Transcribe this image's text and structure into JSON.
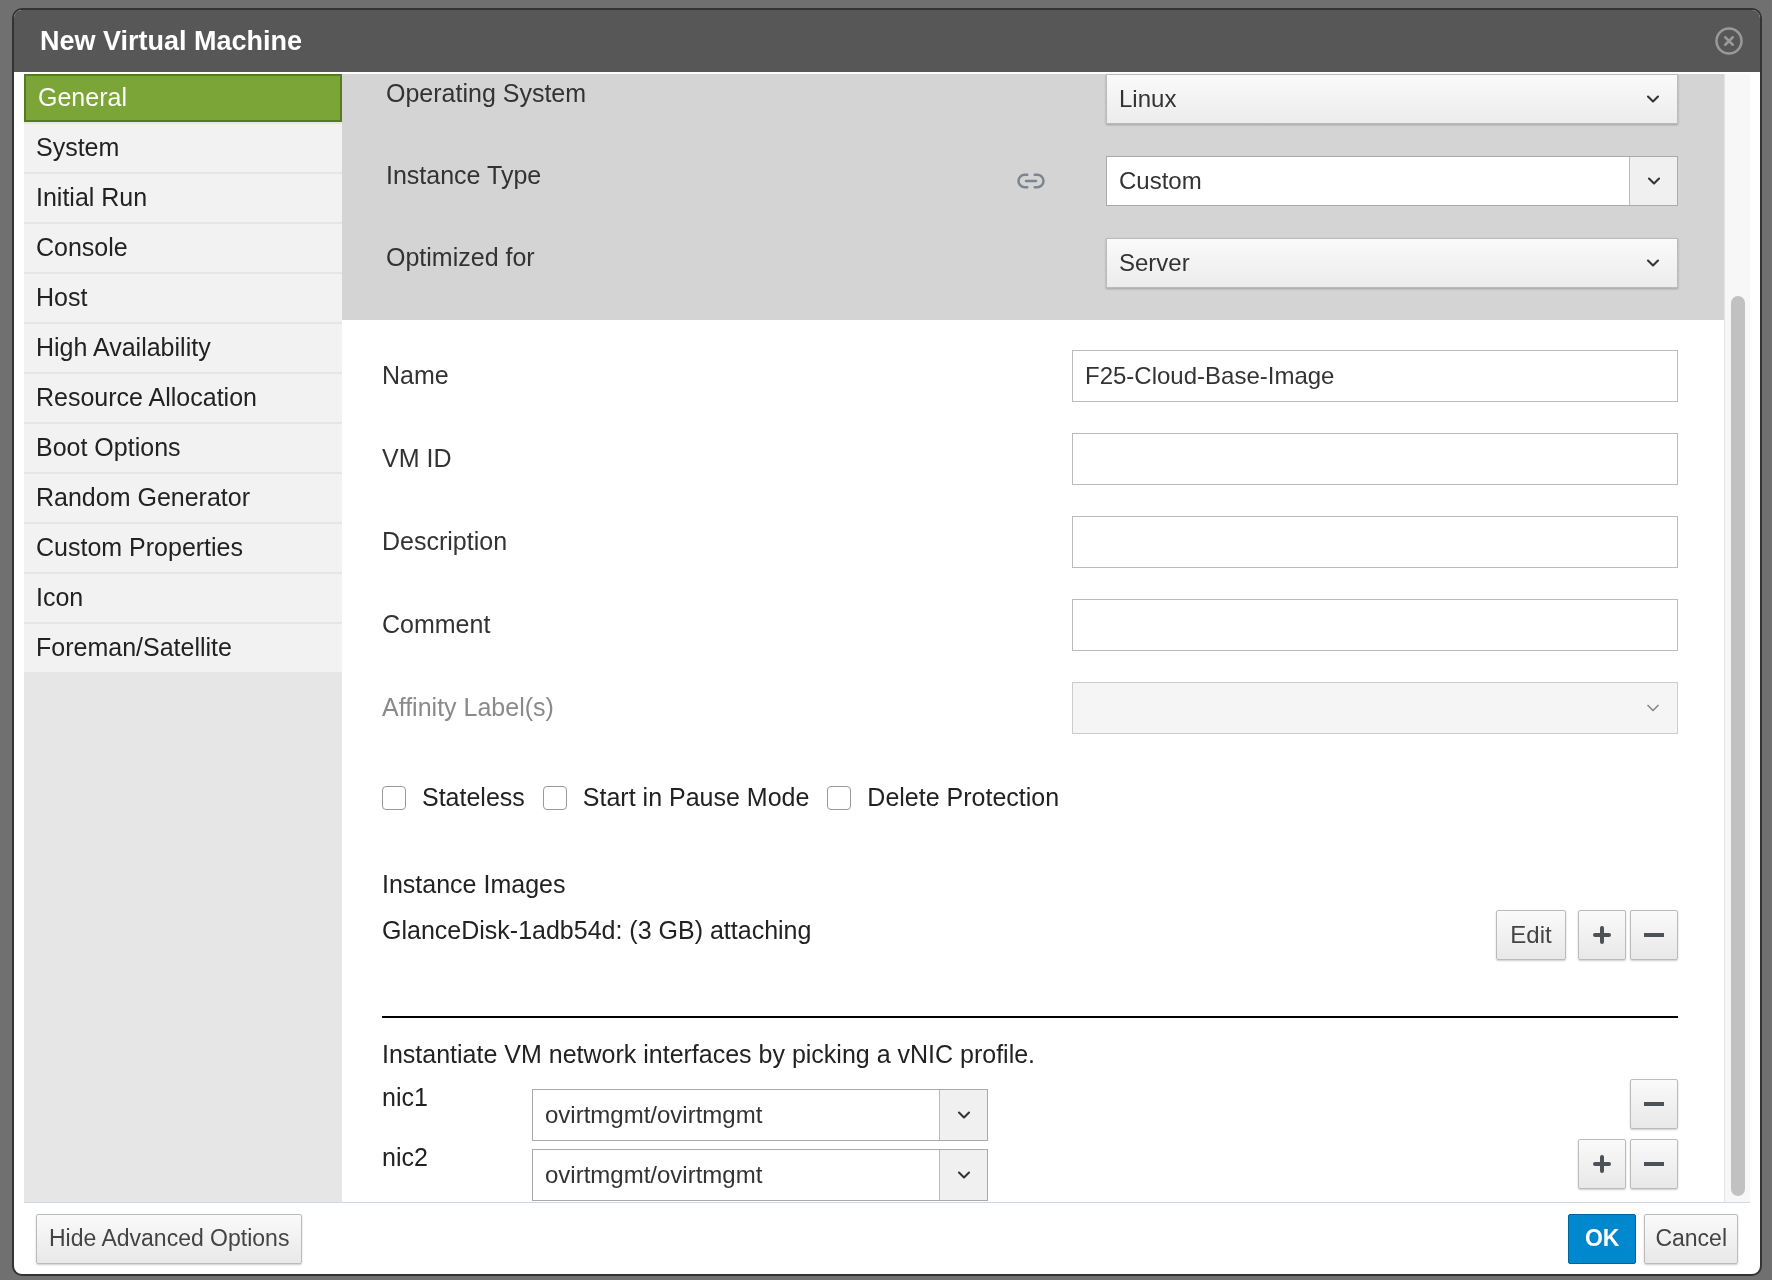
{
  "window": {
    "title": "New Virtual Machine"
  },
  "sidebar": {
    "items": [
      {
        "label": "General",
        "selected": true
      },
      {
        "label": "System",
        "selected": false
      },
      {
        "label": "Initial Run",
        "selected": false
      },
      {
        "label": "Console",
        "selected": false
      },
      {
        "label": "Host",
        "selected": false
      },
      {
        "label": "High Availability",
        "selected": false
      },
      {
        "label": "Resource Allocation",
        "selected": false
      },
      {
        "label": "Boot Options",
        "selected": false
      },
      {
        "label": "Random Generator",
        "selected": false
      },
      {
        "label": "Custom Properties",
        "selected": false
      },
      {
        "label": "Icon",
        "selected": false
      },
      {
        "label": "Foreman/Satellite",
        "selected": false
      }
    ]
  },
  "top_fields": [
    {
      "label": "Operating System",
      "value": "Linux",
      "kind": "select"
    },
    {
      "label": "Instance Type",
      "value": "Custom",
      "kind": "combo"
    },
    {
      "label": "Optimized for",
      "value": "Server",
      "kind": "select"
    }
  ],
  "fields": [
    {
      "label": "Name",
      "value": "F25-Cloud-Base-Image",
      "kind": "text",
      "disabled": false
    },
    {
      "label": "VM ID",
      "kind": "text",
      "disabled": false
    },
    {
      "label": "Description",
      "kind": "text",
      "disabled": false
    },
    {
      "label": "Comment",
      "kind": "text",
      "disabled": false
    },
    {
      "label": "Affinity Label(s)",
      "kind": "select",
      "disabled": true
    }
  ],
  "checkboxes": [
    {
      "label": "Stateless",
      "checked": false
    },
    {
      "label": "Start in Pause Mode",
      "checked": false
    },
    {
      "label": "Delete Protection",
      "checked": false
    }
  ],
  "instance_images": {
    "title": "Instance Images",
    "items": [
      "GlanceDisk-1adb54d: (3 GB) attaching"
    ],
    "edit_button": "Edit"
  },
  "network": {
    "caption": "Instantiate VM network interfaces by picking a vNIC profile.",
    "nics": [
      {
        "name": "nic1",
        "profile": "ovirtmgmt/ovirtmgmt",
        "can_add": false
      },
      {
        "name": "nic2",
        "profile": "ovirtmgmt/ovirtmgmt",
        "can_add": true
      }
    ]
  },
  "footer": {
    "advanced_button": "Hide Advanced Options",
    "ok_button": "OK",
    "cancel_button": "Cancel"
  }
}
